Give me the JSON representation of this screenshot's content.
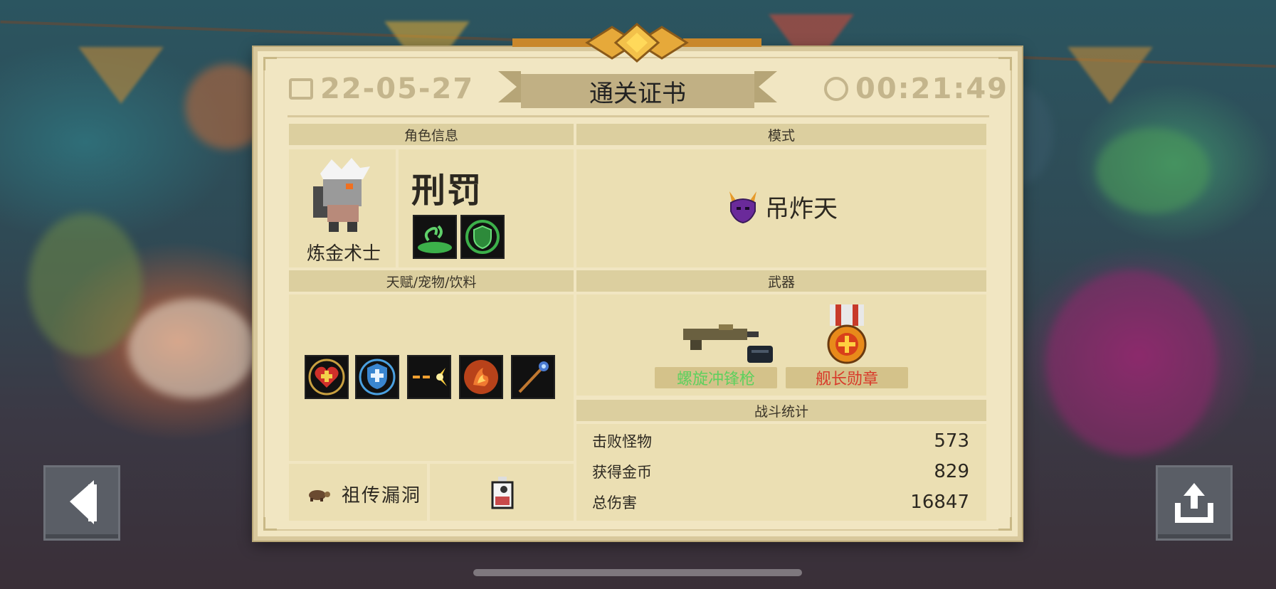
{
  "header": {
    "date": "22-05-27",
    "title": "通关证书",
    "time": "00:21:49",
    "calendar_icon": "calendar-icon",
    "clock_icon": "clock-icon"
  },
  "character": {
    "section_label": "角色信息",
    "class_name": "炼金术士",
    "skill_name": "刑罚",
    "skill_icons": [
      "poison-vortex-icon",
      "green-shield-icon"
    ]
  },
  "mode": {
    "section_label": "模式",
    "name": "吊炸天",
    "icon": "horned-devil-icon"
  },
  "buffs": {
    "section_label": "天赋/宠物/饮料",
    "icons": [
      "heart-plus-icon",
      "shield-plus-icon",
      "bullet-spark-icon",
      "fire-claw-icon",
      "magic-staff-icon"
    ],
    "pet_name": "祖传漏洞",
    "pet_icon": "turtle-icon",
    "drink_icon": "potion-bottle-icon"
  },
  "weapons": {
    "section_label": "武器",
    "items": [
      {
        "name": "螺旋冲锋枪",
        "color": "#5ed05e",
        "icon": "smg-gun-icon"
      },
      {
        "name": "舰长勋章",
        "color": "#d83a2a",
        "icon": "captain-medal-icon"
      }
    ]
  },
  "stats": {
    "section_label": "战斗统计",
    "rows": [
      {
        "label": "击败怪物",
        "value": "573"
      },
      {
        "label": "获得金币",
        "value": "829"
      },
      {
        "label": "总伤害",
        "value": "16847"
      }
    ]
  },
  "nav": {
    "back_icon": "back-arrow-icon",
    "share_icon": "share-icon"
  },
  "colors": {
    "paper": "#f1e6c2",
    "frame": "#d8c89c",
    "accent_gold": "#d4a03a"
  }
}
